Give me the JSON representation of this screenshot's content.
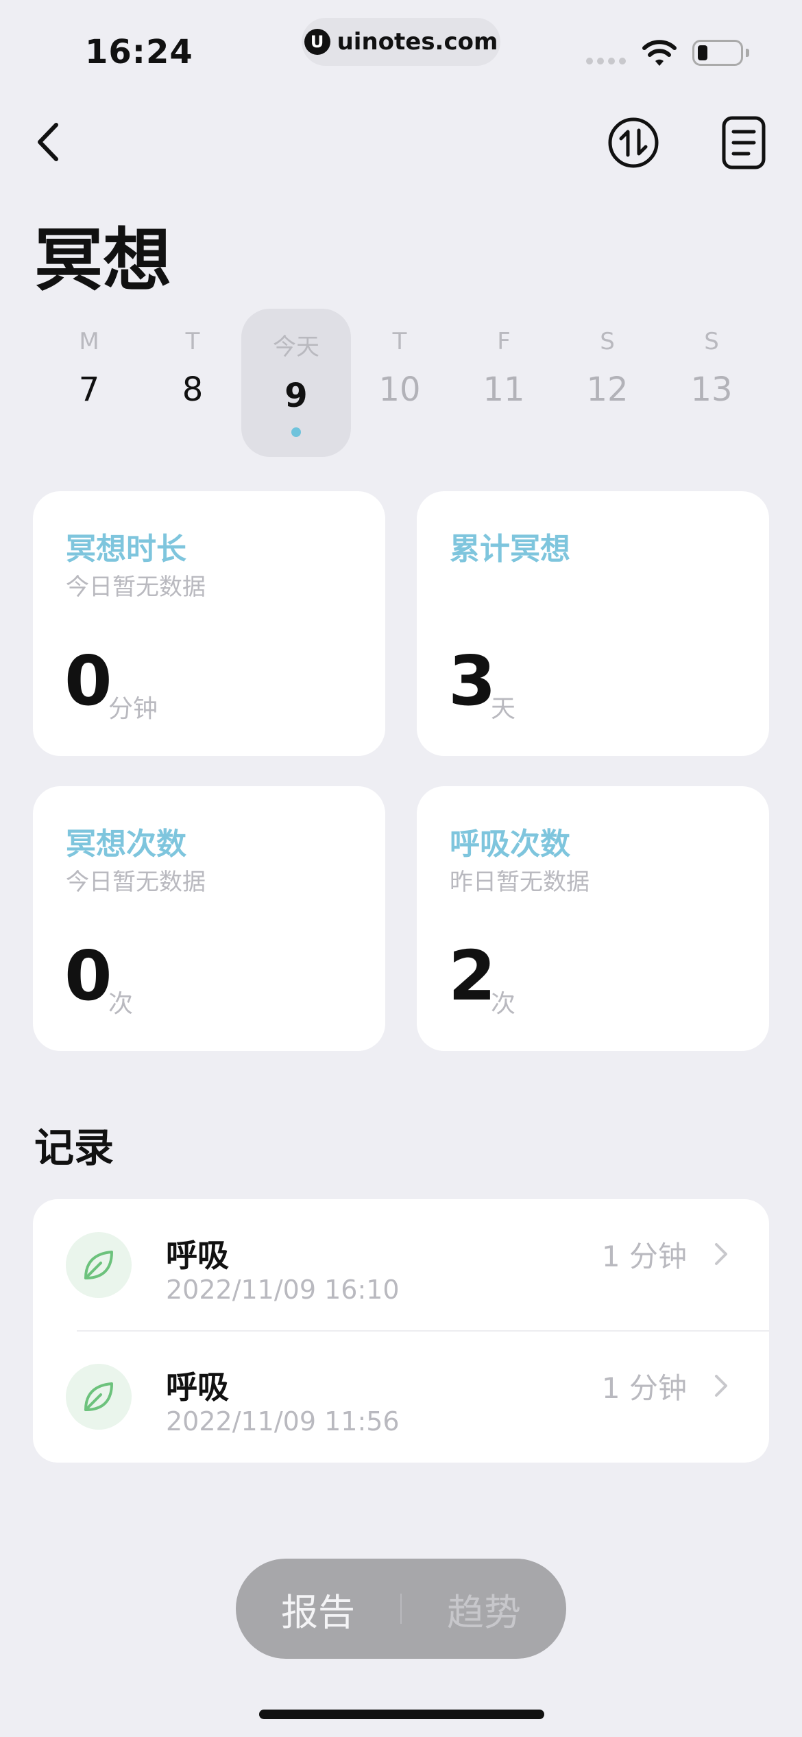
{
  "status_bar": {
    "time": "16:24",
    "url": "uinotes.com",
    "url_logo": "U"
  },
  "page": {
    "title": "冥想"
  },
  "week": [
    {
      "weekday": "M",
      "date": "7",
      "state": "past"
    },
    {
      "weekday": "T",
      "date": "8",
      "state": "past"
    },
    {
      "weekday": "今天",
      "date": "9",
      "state": "today"
    },
    {
      "weekday": "T",
      "date": "10",
      "state": "future"
    },
    {
      "weekday": "F",
      "date": "11",
      "state": "future"
    },
    {
      "weekday": "S",
      "date": "12",
      "state": "future"
    },
    {
      "weekday": "S",
      "date": "13",
      "state": "future"
    }
  ],
  "stats": [
    {
      "title": "冥想时长",
      "subtitle": "今日暂无数据",
      "value": "0",
      "unit": "分钟"
    },
    {
      "title": "累计冥想",
      "subtitle": "",
      "value": "3",
      "unit": "天"
    },
    {
      "title": "冥想次数",
      "subtitle": "今日暂无数据",
      "value": "0",
      "unit": "次"
    },
    {
      "title": "呼吸次数",
      "subtitle": "昨日暂无数据",
      "value": "2",
      "unit": "次"
    }
  ],
  "records_section": {
    "title": "记录"
  },
  "records": [
    {
      "name": "呼吸",
      "datetime": "2022/11/09 16:10",
      "duration": "1 分钟",
      "icon": "leaf-icon"
    },
    {
      "name": "呼吸",
      "datetime": "2022/11/09 11:56",
      "duration": "1 分钟",
      "icon": "leaf-icon"
    }
  ],
  "bottom_toggle": {
    "report": "报告",
    "trend": "趋势"
  },
  "colors": {
    "accent": "#7ec5dd",
    "background": "#eeeef3",
    "leaf": "#6cc27c"
  }
}
